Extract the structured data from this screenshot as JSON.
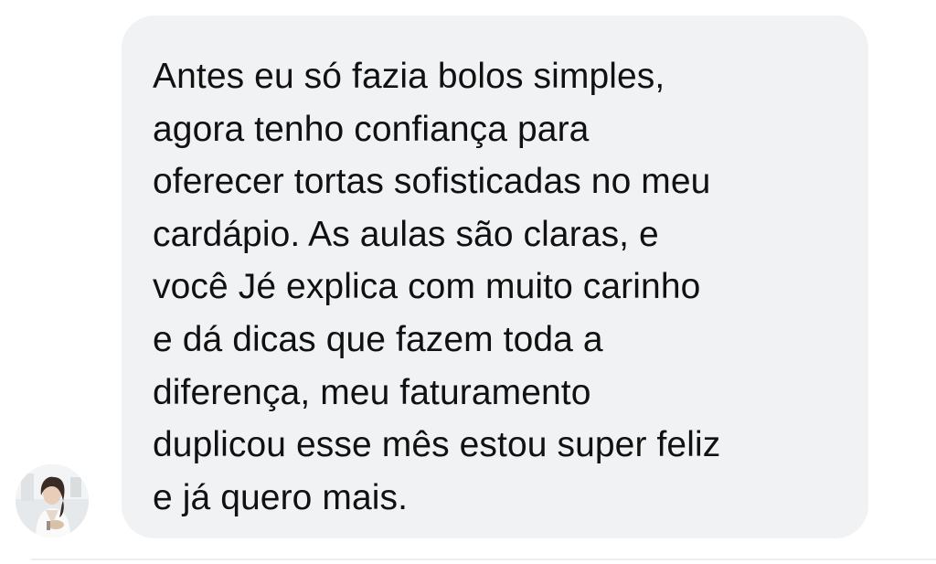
{
  "message": {
    "text": "Antes eu só fazia bolos simples,\nagora tenho confiança para\noferecer tortas sofisticadas no meu\ncardápio. As aulas são claras, e\nvocê Jé explica com muito carinho\ne dá dicas que fazem toda a\ndiferença, meu faturamento\nduplicou esse mês estou super feliz\ne já quero mais.",
    "bubble_color": "#f1f2f4",
    "text_color": "#111111"
  },
  "sender": {
    "avatar_icon": "user-avatar-photo"
  }
}
